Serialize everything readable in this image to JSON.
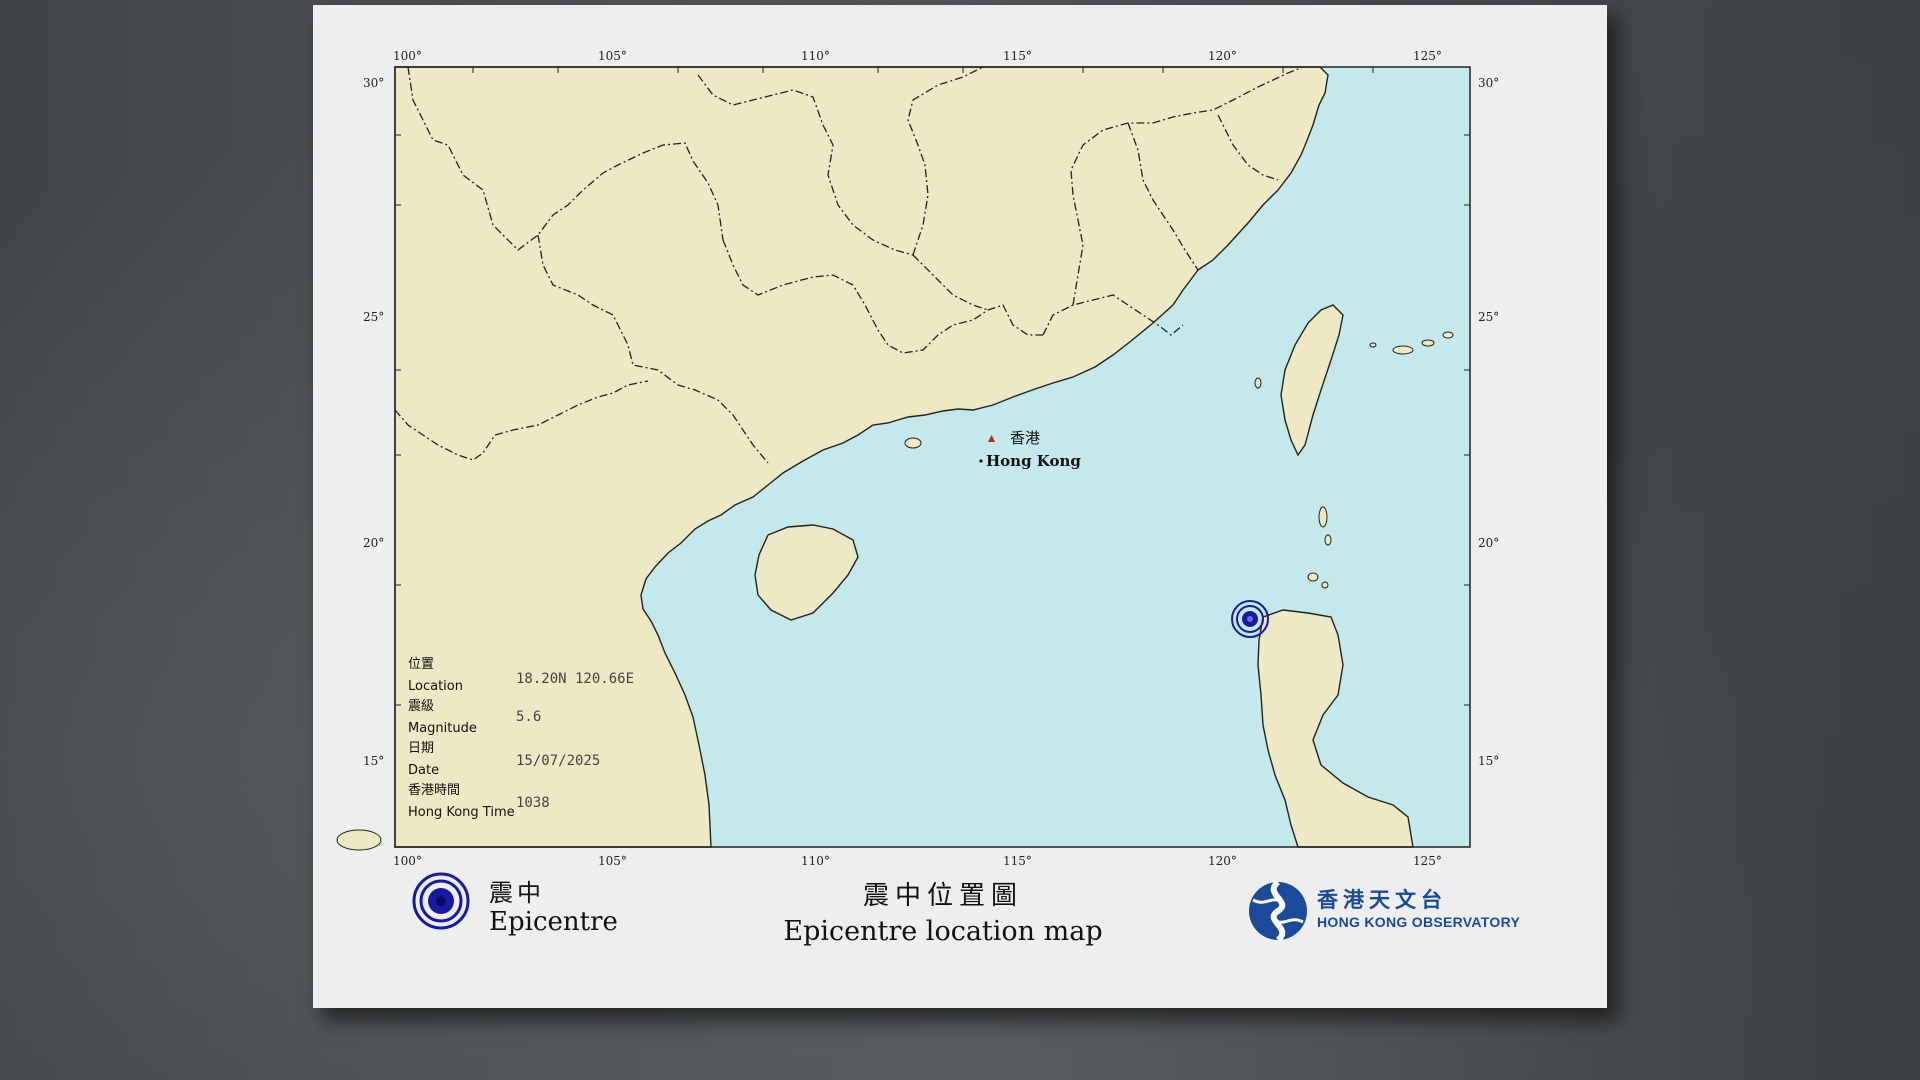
{
  "map": {
    "top_ticks": [
      "100°",
      "105°",
      "110°",
      "115°",
      "120°",
      "125°"
    ],
    "bottom_ticks": [
      "100°",
      "105°",
      "110°",
      "115°",
      "120°",
      "125°"
    ],
    "left_ticks": [
      "30°",
      "25°",
      "20°",
      "15°"
    ],
    "right_ticks": [
      "30°",
      "25°",
      "20°",
      "15°"
    ],
    "colors": {
      "land": "#ece9c4",
      "sea": "#c4e8ec",
      "frame": "#333333",
      "marker": "#c81e1e",
      "epicentre": "#1a1aa0"
    }
  },
  "city": {
    "name_zh": "香港",
    "name_en": "Hong Kong"
  },
  "info": {
    "location_zh": "位置",
    "location_en": "Location",
    "location_value": "18.20N   120.66E",
    "magnitude_zh": "震級",
    "magnitude_en": "Magnitude",
    "magnitude_value": "5.6",
    "date_zh": "日期",
    "date_en": "Date",
    "date_value": "15/07/2025",
    "time_zh": "香港時間",
    "time_en": "Hong Kong Time",
    "time_value": "1038"
  },
  "legend": {
    "label_zh": "震中",
    "label_en": "Epicentre",
    "icon": "epicentre-icon"
  },
  "title": {
    "zh": "震中位置圖",
    "en": "Epicentre location map"
  },
  "logo": {
    "zh": "香港天文台",
    "en": "HONG KONG OBSERVATORY",
    "icon": "hko-logo-icon"
  },
  "epicentre": {
    "lat": 18.2,
    "lon": 120.66
  }
}
